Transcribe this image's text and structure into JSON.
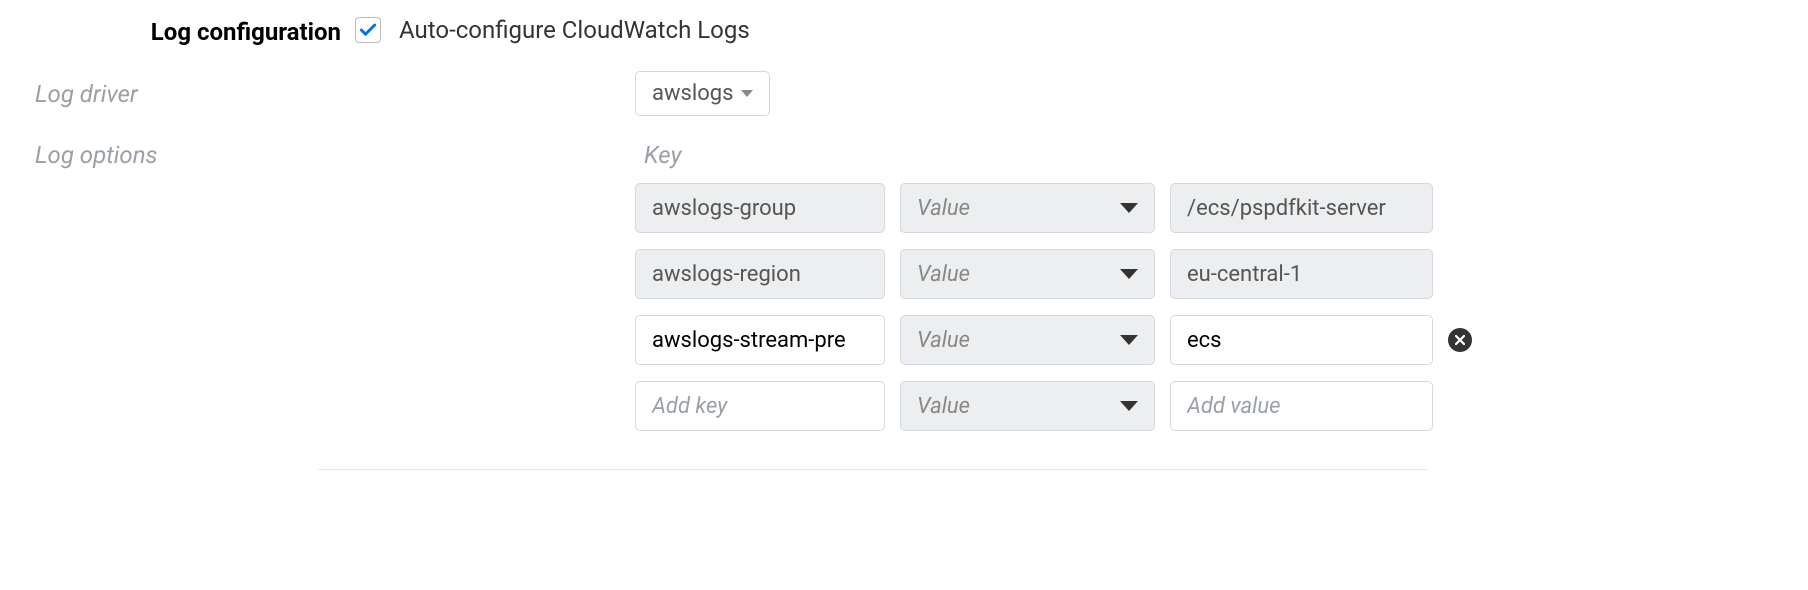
{
  "section": {
    "title": "Log configuration",
    "auto_configure_label": "Auto-configure CloudWatch Logs",
    "auto_configure_checked": true
  },
  "log_driver": {
    "label": "Log driver",
    "value": "awslogs"
  },
  "log_options": {
    "label": "Log options",
    "key_header": "Key",
    "value_select_placeholder": "Value",
    "rows": [
      {
        "key": "awslogs-group",
        "value": "/ecs/pspdfkit-server",
        "readonly": true
      },
      {
        "key": "awslogs-region",
        "value": "eu-central-1",
        "readonly": true
      },
      {
        "key": "awslogs-stream-pre",
        "value": "ecs",
        "readonly": false,
        "removable": true
      }
    ],
    "add_key_placeholder": "Add key",
    "add_value_placeholder": "Add value"
  }
}
